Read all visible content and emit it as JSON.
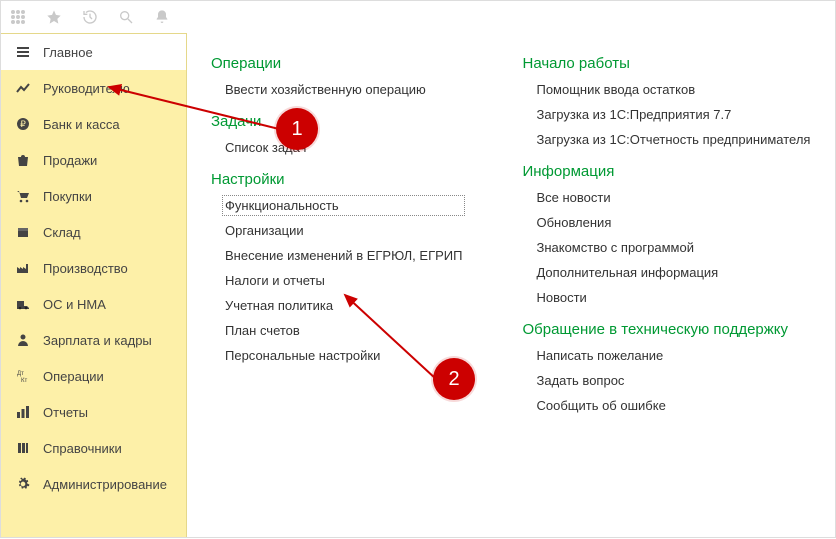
{
  "toolbar_icons": [
    "apps-icon",
    "star-icon",
    "history-icon",
    "search-icon",
    "bell-icon"
  ],
  "sidebar": {
    "items": [
      {
        "icon": "menu-icon",
        "label": "Главное",
        "active": true
      },
      {
        "icon": "trend-icon",
        "label": "Руководителю"
      },
      {
        "icon": "ruble-icon",
        "label": "Банк и касса"
      },
      {
        "icon": "bag-icon",
        "label": "Продажи"
      },
      {
        "icon": "cart-icon",
        "label": "Покупки"
      },
      {
        "icon": "box-icon",
        "label": "Склад"
      },
      {
        "icon": "factory-icon",
        "label": "Производство"
      },
      {
        "icon": "truck-icon",
        "label": "ОС и НМА"
      },
      {
        "icon": "person-icon",
        "label": "Зарплата и кадры"
      },
      {
        "icon": "dtkt-icon",
        "label": "Операции"
      },
      {
        "icon": "bars-icon",
        "label": "Отчеты"
      },
      {
        "icon": "books-icon",
        "label": "Справочники"
      },
      {
        "icon": "gear-icon",
        "label": "Администрирование"
      }
    ]
  },
  "content": {
    "left": [
      {
        "title": "Операции",
        "links": [
          "Ввести хозяйственную операцию"
        ]
      },
      {
        "title": "Задачи",
        "links": [
          "Список задач"
        ]
      },
      {
        "title": "Настройки",
        "links": [
          "Функциональность",
          "Организации",
          "Внесение изменений в ЕГРЮЛ, ЕГРИП",
          "Налоги и отчеты",
          "Учетная политика",
          "План счетов",
          "Персональные настройки"
        ]
      }
    ],
    "right": [
      {
        "title": "Начало работы",
        "links": [
          "Помощник ввода остатков",
          "Загрузка из 1С:Предприятия 7.7",
          "Загрузка из 1С:Отчетность предпринимателя"
        ]
      },
      {
        "title": "Информация",
        "links": [
          "Все новости",
          "Обновления",
          "Знакомство с программой",
          "Дополнительная информация",
          "Новости"
        ]
      },
      {
        "title": "Обращение в техническую поддержку",
        "links": [
          "Написать пожелание",
          "Задать вопрос",
          "Сообщить об ошибке"
        ]
      }
    ]
  },
  "selected_link": "Функциональность",
  "markers": {
    "m1": "1",
    "m2": "2"
  }
}
